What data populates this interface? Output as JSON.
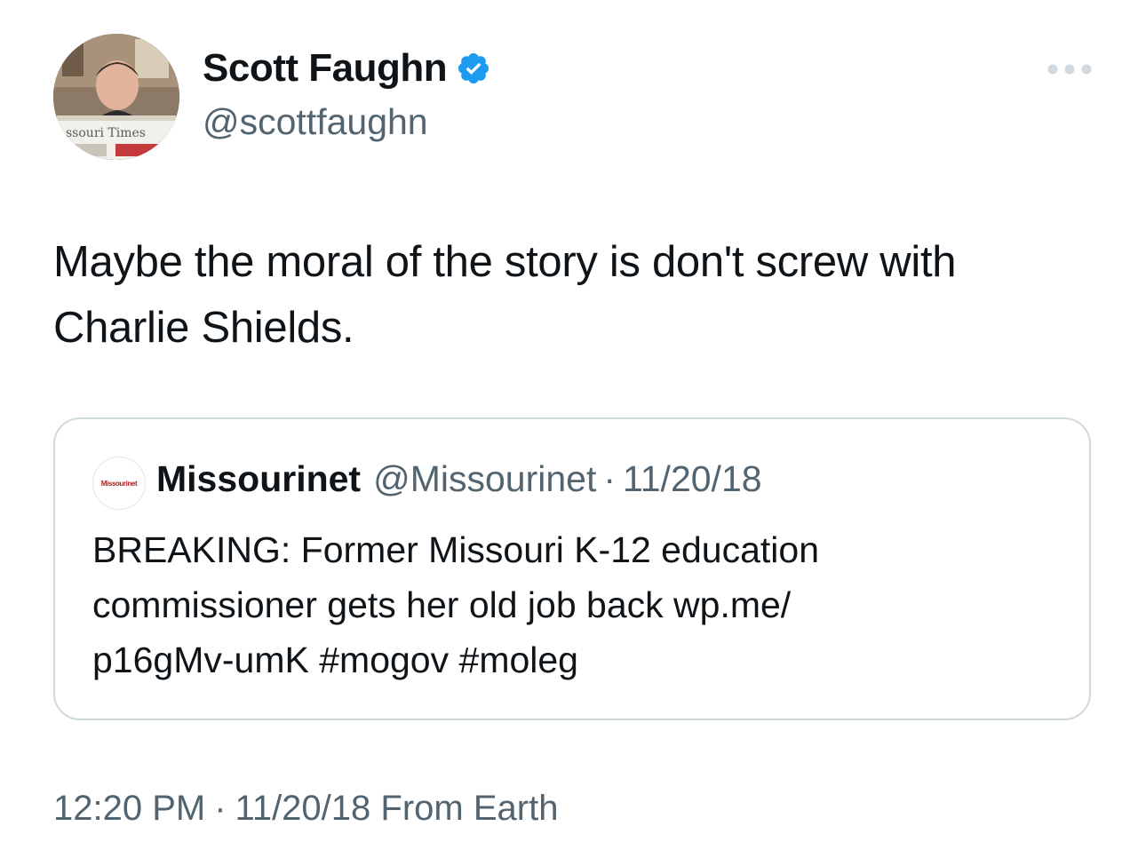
{
  "author": {
    "name": "Scott Faughn",
    "handle": "@scottfaughn",
    "avatar_icon": "profile-photo"
  },
  "tweet": {
    "text_line1": "Maybe the moral of the story is don't screw with",
    "text_line2": "Charlie Shields."
  },
  "quote": {
    "avatar_text": "Missourinet",
    "name": "Missourinet",
    "handle": "@Missourinet",
    "separator": "·",
    "date": "11/20/18",
    "text_line1": "BREAKING: Former Missouri K-12 education",
    "text_line2a": "commissioner gets her old job back ",
    "link_part1": "wp.me/",
    "link_part2": "p16gMv-umK",
    "hashtag1": "#mogov",
    "hashtag2": "#moleg"
  },
  "meta": {
    "time": "12:20 PM",
    "separator": "·",
    "date": "11/20/18",
    "source": "From Earth"
  },
  "colors": {
    "verified": "#1d9bf0",
    "secondary_text": "#536471",
    "border": "#cfd9de",
    "missourinet_red": "#b31b1b"
  }
}
